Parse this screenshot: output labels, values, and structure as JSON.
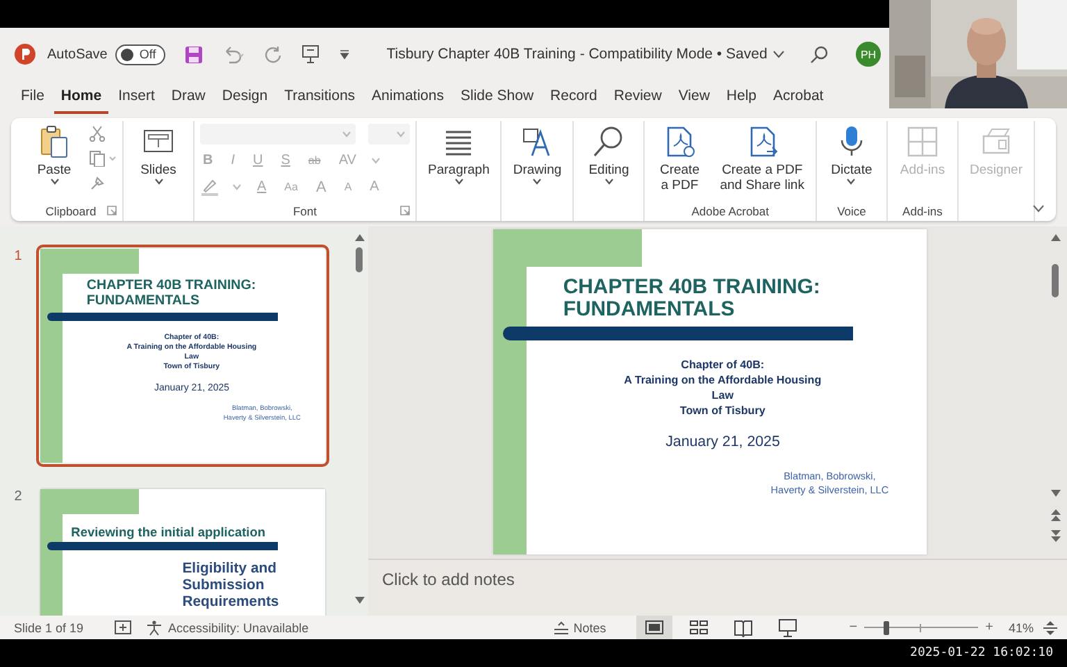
{
  "title_bar": {
    "autosave_label": "AutoSave",
    "autosave_toggle": "Off",
    "autosave_on": false,
    "document_title": "Tisbury Chapter 40B Training - Compatibility Mode • Saved",
    "avatar": "PH"
  },
  "menu_tabs": [
    {
      "label": "File",
      "selected": false
    },
    {
      "label": "Home",
      "selected": true
    },
    {
      "label": "Insert",
      "selected": false
    },
    {
      "label": "Draw",
      "selected": false
    },
    {
      "label": "Design",
      "selected": false
    },
    {
      "label": "Transitions",
      "selected": false
    },
    {
      "label": "Animations",
      "selected": false
    },
    {
      "label": "Slide Show",
      "selected": false
    },
    {
      "label": "Record",
      "selected": false
    },
    {
      "label": "Review",
      "selected": false
    },
    {
      "label": "View",
      "selected": false
    },
    {
      "label": "Help",
      "selected": false
    },
    {
      "label": "Acrobat",
      "selected": false
    }
  ],
  "ribbon": {
    "groups": [
      {
        "kind": "clipboard",
        "label": "Clipboard",
        "buttons": [
          {
            "label": "Paste",
            "disabled": false,
            "dropdown": true
          }
        ]
      },
      {
        "kind": "buttons",
        "buttons": [
          {
            "label": "Slides",
            "disabled": false,
            "dropdown": true
          }
        ]
      },
      {
        "kind": "font",
        "label": "Font",
        "disabled": true,
        "style_buttons": [
          "B",
          "I",
          "U",
          "S",
          "ab",
          "AV"
        ],
        "size_buttons": [
          "A",
          "Aa",
          "A",
          "A",
          "A"
        ]
      },
      {
        "kind": "buttons",
        "buttons": [
          {
            "label": "Paragraph",
            "disabled": false,
            "dropdown": true
          }
        ]
      },
      {
        "kind": "buttons",
        "buttons": [
          {
            "label": "Drawing",
            "disabled": false,
            "dropdown": true
          }
        ]
      },
      {
        "kind": "buttons",
        "buttons": [
          {
            "label": "Editing",
            "disabled": false,
            "dropdown": true
          }
        ]
      },
      {
        "kind": "buttons",
        "label": "Adobe Acrobat",
        "buttons": [
          {
            "label": "Create\na PDF",
            "disabled": false,
            "dropdown": false
          },
          {
            "label": "Create a PDF\nand Share link",
            "disabled": false,
            "dropdown": false
          }
        ]
      },
      {
        "kind": "buttons",
        "label": "Voice",
        "buttons": [
          {
            "label": "Dictate",
            "disabled": false,
            "dropdown": true
          }
        ]
      },
      {
        "kind": "buttons",
        "label": "Add-ins",
        "buttons": [
          {
            "label": "Add-ins",
            "disabled": true,
            "dropdown": false
          }
        ]
      },
      {
        "kind": "buttons",
        "buttons": [
          {
            "label": "Designer",
            "disabled": true,
            "dropdown": false
          }
        ]
      }
    ]
  },
  "slides": [
    {
      "number": "1",
      "selected": true,
      "kind": "title",
      "title": "CHAPTER 40B TRAINING:\nFUNDAMENTALS",
      "subtitle": "Chapter of 40B:\nA Training on the Affordable Housing\nLaw\nTown of Tisbury",
      "date": "January 21, 2025",
      "author": "Blatman, Bobrowski,\nHaverty & Silverstein, LLC"
    },
    {
      "number": "2",
      "selected": false,
      "kind": "section",
      "title": "Reviewing the initial application",
      "body": "Eligibility and\nSubmission\nRequirements"
    }
  ],
  "editor": {
    "slide": {
      "kind": "title",
      "title": "CHAPTER 40B TRAINING:\nFUNDAMENTALS",
      "subtitle": "Chapter of 40B:\nA Training on the Affordable Housing\nLaw\nTown of Tisbury",
      "date": "January 21, 2025",
      "author": "Blatman, Bobrowski,\nHaverty & Silverstein, LLC"
    },
    "notes": {
      "placeholder": "Click to add notes"
    }
  },
  "status_bar": {
    "slide_count": "Slide 1 of 19",
    "accessibility": "Accessibility: Unavailable",
    "notes": "Notes",
    "views": [
      {
        "selected": true
      },
      {
        "selected": false
      },
      {
        "selected": false
      },
      {
        "selected": false
      }
    ],
    "zoom": {
      "minus": "−",
      "plus": "+",
      "level": 0.19,
      "reading": "41%"
    }
  },
  "recording_timestamp": "2025-01-22 16:02:10"
}
